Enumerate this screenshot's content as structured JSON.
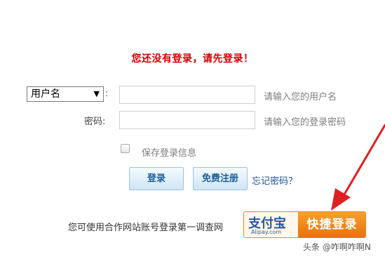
{
  "notice": "您还没有登录，请先登录！",
  "login_form": {
    "account_type_selected": "用户名",
    "colon": ":",
    "username_hint": "请输入您的用户名",
    "password_label": "密码:",
    "password_hint": "请输入您的登录密码",
    "remember_label": "保存登录信息",
    "login_button": "登录",
    "register_button": "免费注册",
    "forgot_link": "忘记密码？"
  },
  "partner_login": {
    "text": "您可使用合作网站账号登录第一调查网",
    "alipay_logo": "支付宝",
    "alipay_domain": "Alipay.com",
    "quick_login": "快捷登录"
  },
  "watermark": "头条 @咋啊咋啊N",
  "icons": {
    "dropdown": "triangle-down-icon",
    "annotation": "red-arrow-icon"
  },
  "colors": {
    "notice": "#cc0000",
    "button_text": "#1b5e98",
    "alipay_orange": "#e8720a",
    "arrow": "#e02020"
  }
}
